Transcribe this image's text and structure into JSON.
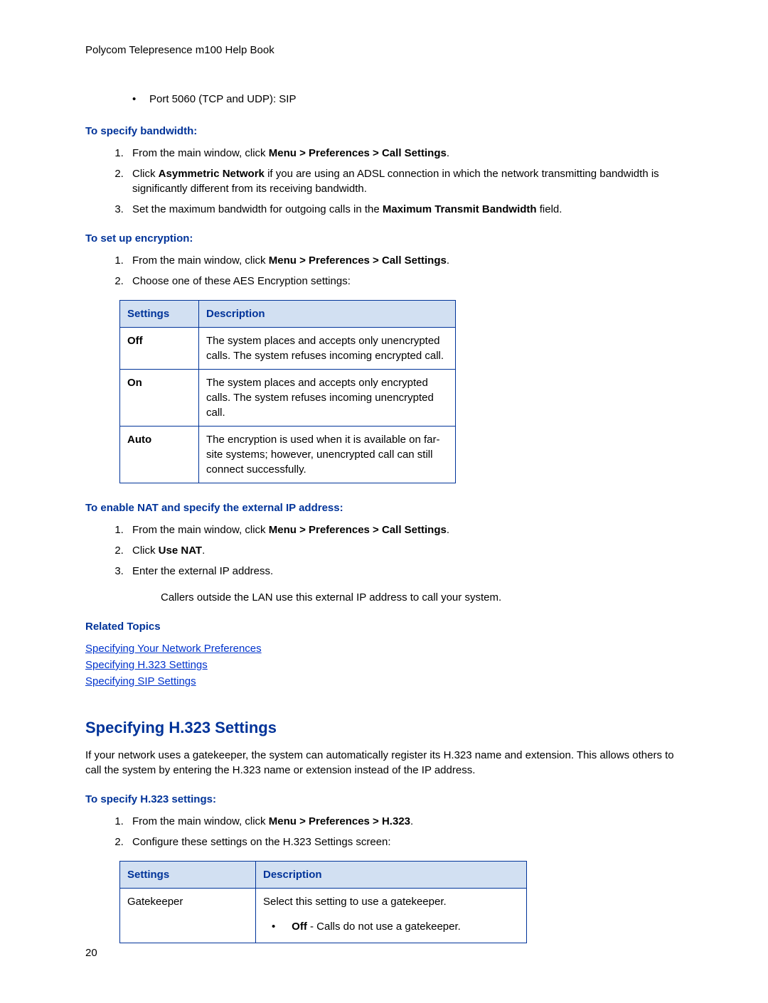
{
  "header": "Polycom Telepresence m100 Help Book",
  "port_bullet": "Port 5060 (TCP and UDP): SIP",
  "bandwidth": {
    "heading": "To specify bandwidth:",
    "step1_pre": "From the main window, click ",
    "step1_bold": "Menu > Preferences > Call Settings",
    "step1_post": ".",
    "step2_pre": "Click ",
    "step2_bold": "Asymmetric Network",
    "step2_post": " if you are using an ADSL connection in which the network transmitting bandwidth is significantly different from its receiving bandwidth.",
    "step3_pre": "Set the maximum bandwidth for outgoing calls in the ",
    "step3_bold": "Maximum Transmit Bandwidth",
    "step3_post": " field."
  },
  "encryption": {
    "heading": "To set up encryption:",
    "step1_pre": "From the main window, click ",
    "step1_bold": "Menu > Preferences > Call Settings",
    "step1_post": ".",
    "step2": "Choose one of these AES Encryption settings:",
    "table": {
      "col1": "Settings",
      "col2": "Description",
      "rows": [
        {
          "setting": "Off",
          "desc": "The system places and accepts only unencrypted calls. The system refuses incoming encrypted call."
        },
        {
          "setting": "On",
          "desc": "The system places and accepts only encrypted calls. The system refuses incoming unencrypted call."
        },
        {
          "setting": "Auto",
          "desc": "The encryption is used when it is available on far-site systems; however, unencrypted call can still connect successfully."
        }
      ]
    }
  },
  "nat": {
    "heading": "To enable NAT and specify the external IP address:",
    "step1_pre": "From the main window, click ",
    "step1_bold": "Menu > Preferences > Call Settings",
    "step1_post": ".",
    "step2_pre": "Click ",
    "step2_bold": "Use NAT",
    "step2_post": ".",
    "step3": "Enter the external IP address.",
    "note": "Callers outside the LAN use this external IP address to call your system."
  },
  "related": {
    "heading": "Related Topics",
    "links": [
      "Specifying Your Network Preferences",
      "Specifying H.323 Settings",
      "Specifying SIP Settings"
    ]
  },
  "h323": {
    "title": "Specifying H.323 Settings",
    "intro": "If your network uses a gatekeeper, the system can automatically register its H.323 name and extension. This allows others to call the system by entering the H.323 name or extension instead of the IP address.",
    "heading": "To specify H.323 settings:",
    "step1_pre": "From the main window, click ",
    "step1_bold": "Menu > Preferences > H.323",
    "step1_post": ".",
    "step2": "Configure these settings on the H.323 Settings screen:",
    "table": {
      "col1": "Settings",
      "col2": "Description",
      "row1_setting": "Gatekeeper",
      "row1_desc_line1": "Select this setting to use a gatekeeper.",
      "row1_bullet_bold": "Off",
      "row1_bullet_post": " - Calls do not use a gatekeeper."
    }
  },
  "page_number": "20"
}
